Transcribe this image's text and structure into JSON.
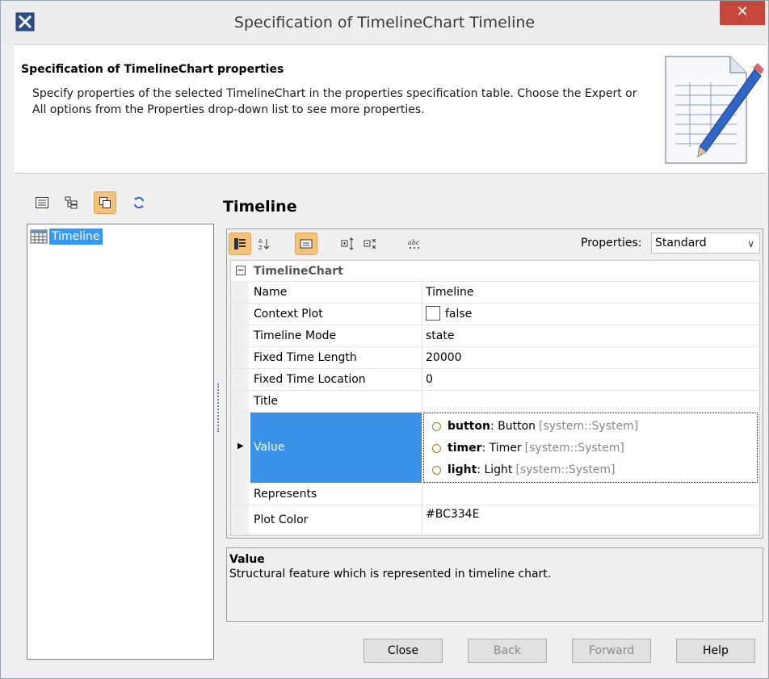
{
  "window": {
    "title": "Specification of TimelineChart Timeline",
    "close_symbol": "✕"
  },
  "header": {
    "title": "Specification of TimelineChart properties",
    "description": "Specify properties of the selected TimelineChart in the properties specification table. Choose the Expert or All options from the Properties drop-down list to see more properties."
  },
  "left": {
    "toolbar": [
      "list-view-icon",
      "tree-view-icon",
      "copy-icon",
      "refresh-icon"
    ],
    "tree": [
      {
        "label": "Timeline",
        "selected": true
      }
    ]
  },
  "right": {
    "title": "Timeline",
    "properties_label": "Properties:",
    "properties_value": "Standard",
    "table": {
      "category": "TimelineChart",
      "rows": [
        {
          "name": "Name",
          "value": "Timeline"
        },
        {
          "name": "Context Plot",
          "value": "false"
        },
        {
          "name": "Timeline Mode",
          "value": "state"
        },
        {
          "name": "Fixed Time Length",
          "value": "20000"
        },
        {
          "name": "Fixed Time Location",
          "value": "0"
        },
        {
          "name": "Title",
          "value": ""
        }
      ],
      "value_row": {
        "name": "Value",
        "items": [
          {
            "name": "button",
            "type": " : Button",
            "scope": "[system::System]"
          },
          {
            "name": "timer",
            "type": " : Timer",
            "scope": "[system::System]"
          },
          {
            "name": "light",
            "type": " : Light",
            "scope": "[system::System]"
          }
        ]
      },
      "represents": {
        "name": "Represents",
        "value": ""
      },
      "plot_color": {
        "name": "Plot Color",
        "value": "#BC334E"
      }
    },
    "description": {
      "title": "Value",
      "text": "Structural feature which is represented in timeline chart."
    }
  },
  "buttons": {
    "close": "Close",
    "back": "Back",
    "forward": "Forward",
    "help": "Help"
  },
  "colors": {
    "selection": "#3a92e8",
    "accent": "#f5c27a",
    "close": "#c7473a"
  }
}
